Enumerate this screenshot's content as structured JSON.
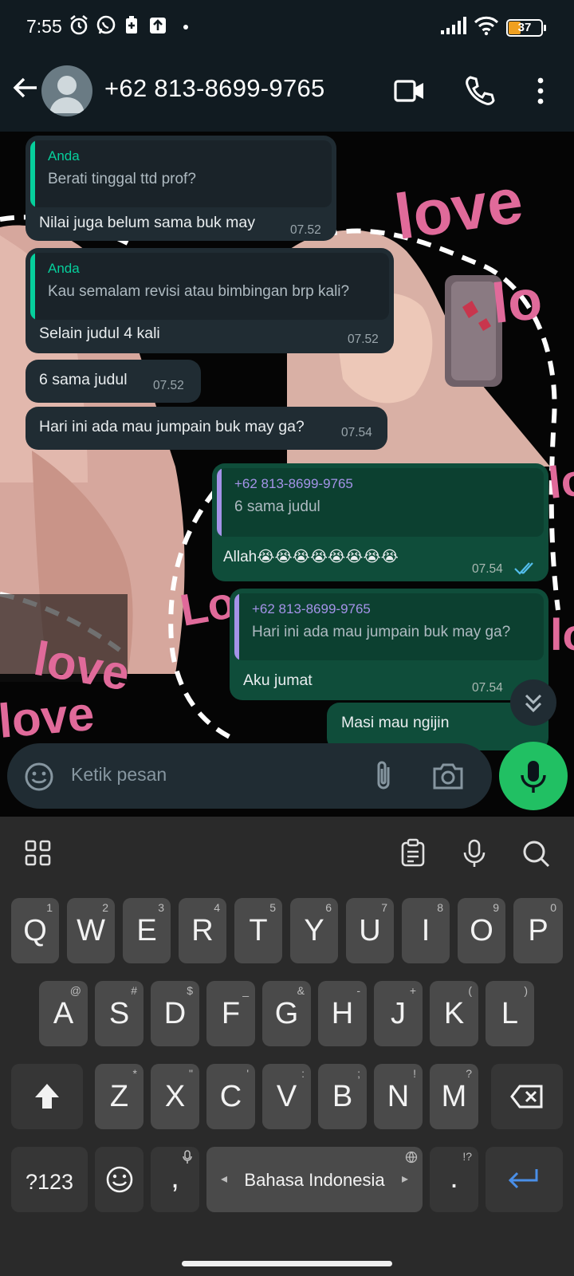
{
  "status_bar": {
    "time": "7:55",
    "battery": "37",
    "icons": [
      "alarm-icon",
      "whatsapp-icon",
      "battery-saver-icon",
      "upload-icon",
      "dot-icon",
      "signal-icon",
      "wifi-icon",
      "battery-icon"
    ]
  },
  "header": {
    "contact": "+62 813-8699-9765",
    "icons": [
      "back-icon",
      "avatar-icon",
      "video-call-icon",
      "voice-call-icon",
      "more-icon"
    ]
  },
  "messages": [
    {
      "dir": "in",
      "quote_author": "Anda",
      "quote_text": "Berati tinggal ttd prof?",
      "text": "Nilai juga belum sama buk may",
      "time": "07.52"
    },
    {
      "dir": "in",
      "quote_author": "Anda",
      "quote_text": "Kau semalam revisi atau bimbingan brp kali?",
      "text": "Selain judul 4 kali",
      "time": "07.52"
    },
    {
      "dir": "in",
      "text": "6 sama judul",
      "time": "07.52"
    },
    {
      "dir": "in",
      "text": "Hari ini ada mau jumpain buk may ga?",
      "time": "07.54"
    },
    {
      "dir": "out",
      "quote_author": "+62 813-8699-9765",
      "quote_text": "6 sama judul",
      "text": "Allah😭😭😭😭😭😭😭😭",
      "time": "07.54",
      "read": true
    },
    {
      "dir": "out",
      "quote_author": "+62 813-8699-9765",
      "quote_text": "Hari ini ada mau jumpain buk may ga?",
      "text": "Aku jumat",
      "time": "07.54"
    },
    {
      "dir": "out",
      "text": "Masi mau ngijin",
      "partial": true
    }
  ],
  "composer": {
    "placeholder": "Ketik pesan",
    "icons": [
      "emoji-icon",
      "attach-icon",
      "camera-icon",
      "mic-icon"
    ]
  },
  "keyboard": {
    "toolbar_icons": [
      "apps-grid-icon",
      "clipboard-icon",
      "voice-input-icon",
      "search-icon"
    ],
    "row1": [
      {
        "key": "Q",
        "hint": "1"
      },
      {
        "key": "W",
        "hint": "2"
      },
      {
        "key": "E",
        "hint": "3"
      },
      {
        "key": "R",
        "hint": "4"
      },
      {
        "key": "T",
        "hint": "5"
      },
      {
        "key": "Y",
        "hint": "6"
      },
      {
        "key": "U",
        "hint": "7"
      },
      {
        "key": "I",
        "hint": "8"
      },
      {
        "key": "O",
        "hint": "9"
      },
      {
        "key": "P",
        "hint": "0"
      }
    ],
    "row2": [
      {
        "key": "A",
        "hint": "@"
      },
      {
        "key": "S",
        "hint": "#"
      },
      {
        "key": "D",
        "hint": "$"
      },
      {
        "key": "F",
        "hint": "_"
      },
      {
        "key": "G",
        "hint": "&"
      },
      {
        "key": "H",
        "hint": "-"
      },
      {
        "key": "J",
        "hint": "+"
      },
      {
        "key": "K",
        "hint": "("
      },
      {
        "key": "L",
        "hint": ")"
      }
    ],
    "row3": [
      {
        "key": "Z",
        "hint": "*"
      },
      {
        "key": "X",
        "hint": "\""
      },
      {
        "key": "C",
        "hint": "'"
      },
      {
        "key": "V",
        "hint": ":"
      },
      {
        "key": "B",
        "hint": ";"
      },
      {
        "key": "N",
        "hint": "!"
      },
      {
        "key": "M",
        "hint": "?"
      }
    ],
    "symbols_key": "?123",
    "comma_key": ",",
    "period_key": ".",
    "period_hint": "!?",
    "space_label": "Bahasa Indonesia",
    "space_left_arrow": "◂",
    "space_right_arrow": "▸"
  }
}
